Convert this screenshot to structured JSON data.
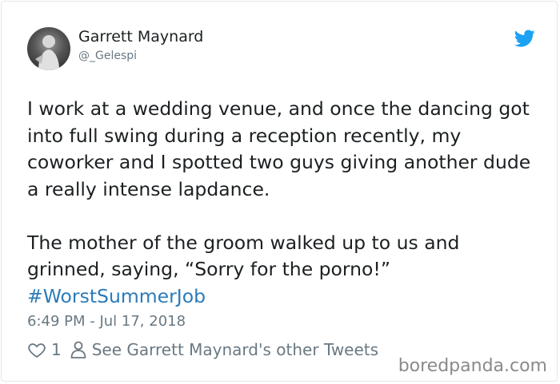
{
  "tweet": {
    "author_name": "Garrett Maynard",
    "author_handle": "@_Gelespi",
    "paragraph_1": "I work at a wedding venue, and once the dancing got into full swing during a reception recently, my coworker and I spotted two guys giving another dude a really intense lapdance.",
    "paragraph_2": "The mother of the groom walked up to us and grinned, saying, “Sorry for the porno!”",
    "hashtag": "#WorstSummerJob",
    "timestamp": "6:49 PM - Jul 17, 2018",
    "like_count": "1",
    "other_tweets_link": "See Garrett Maynard's other Tweets"
  },
  "icons": {
    "brand": "twitter-bird-icon",
    "like": "heart-icon",
    "profile": "person-icon"
  },
  "colors": {
    "twitter_blue": "#1da1f2",
    "hashtag": "#2b7bb9",
    "muted_text": "#697882"
  },
  "watermark": "boredpanda.com"
}
